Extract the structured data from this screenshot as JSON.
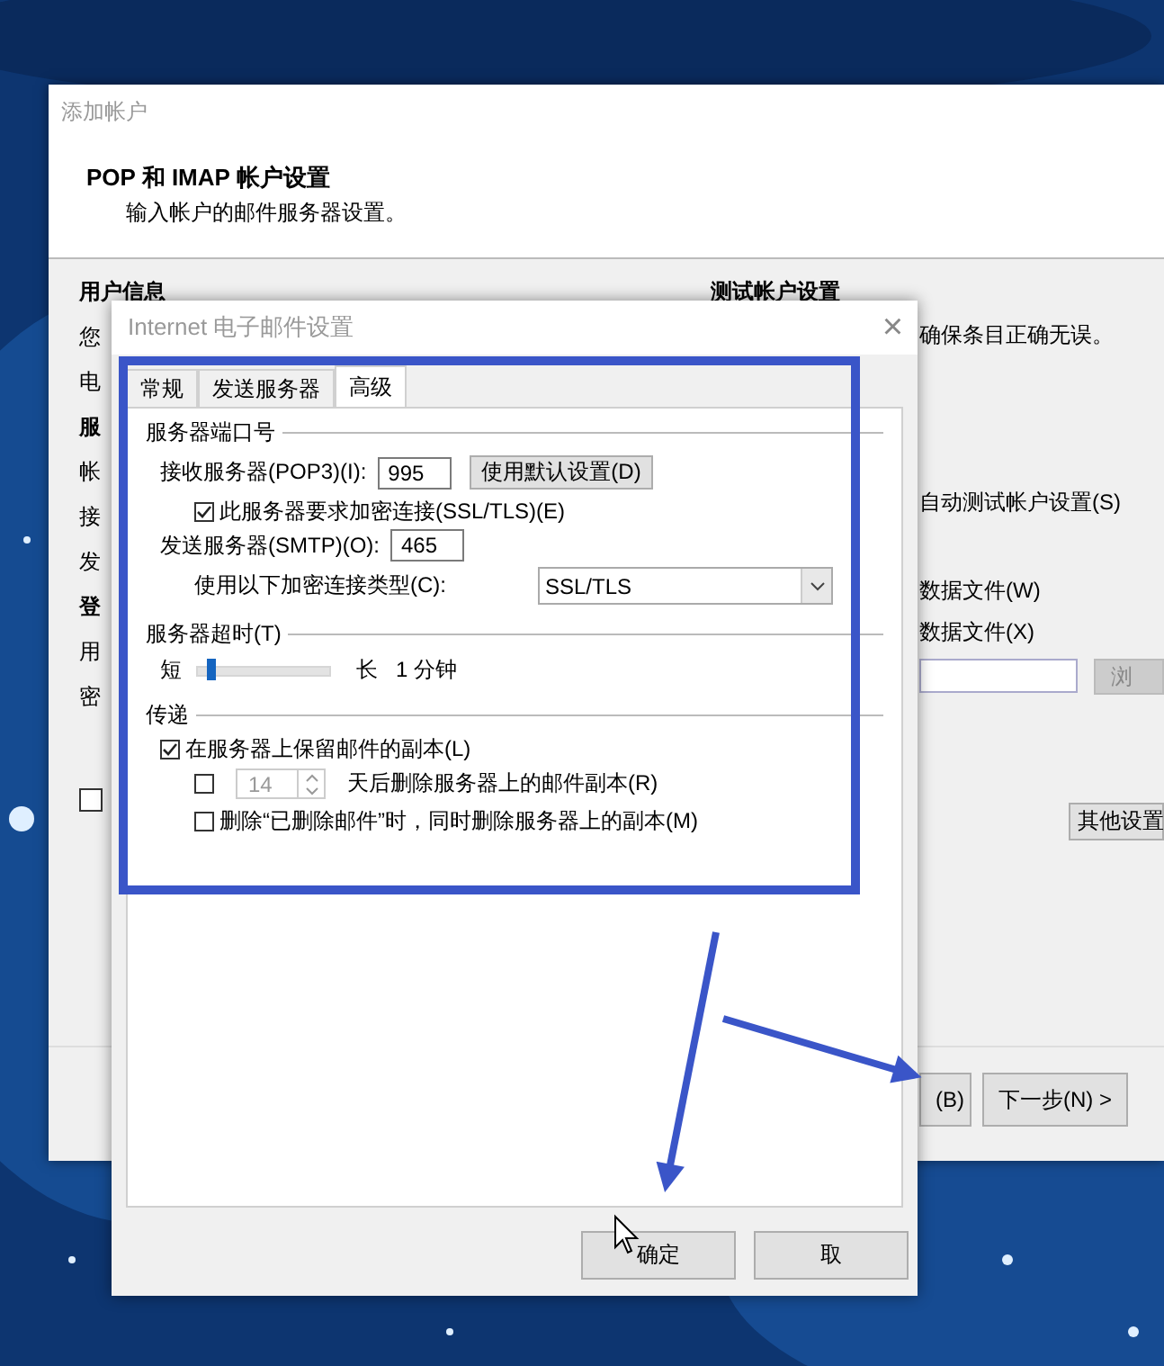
{
  "main_window": {
    "title": "添加帐户",
    "heading": "POP 和 IMAP 帐户设置",
    "subheading": "输入帐户的邮件服务器设置。",
    "left_labels": [
      {
        "text": "用户信息",
        "kind": "heading"
      },
      {
        "text": "您",
        "kind": "label"
      },
      {
        "text": "电",
        "kind": "label"
      },
      {
        "text": "服",
        "kind": "heading"
      },
      {
        "text": "帐",
        "kind": "label"
      },
      {
        "text": "接",
        "kind": "label"
      },
      {
        "text": "发",
        "kind": "label"
      },
      {
        "text": "登",
        "kind": "heading"
      },
      {
        "text": "用",
        "kind": "label"
      },
      {
        "text": "密",
        "kind": "label"
      }
    ],
    "left_checkbox": {
      "checked": false
    },
    "test_heading": "测试帐户设置",
    "test_note": "确保条目正确无误。",
    "auto_test_label": "自动测试帐户设置(S)",
    "data_file_options": [
      "数据文件(W)",
      "数据文件(X)"
    ],
    "browse_button": {
      "label": "浏",
      "disabled": true
    },
    "more_settings_button": "其他设置",
    "buttons": [
      "(B)",
      "下一步(N) >"
    ]
  },
  "dialog": {
    "title": "Internet 电子邮件设置",
    "close": "×",
    "tabs": [
      {
        "label": "常规",
        "selected": false
      },
      {
        "label": "发送服务器",
        "selected": false
      },
      {
        "label": "高级",
        "selected": true
      }
    ],
    "port_group": "服务器端口号",
    "incoming_label": "接收服务器(POP3)(I):",
    "incoming_port": "995",
    "default_button": "使用默认设置(D)",
    "ssl_checkbox": {
      "label": "此服务器要求加密连接(SSL/TLS)(E)",
      "checked": true
    },
    "outgoing_label": "发送服务器(SMTP)(O):",
    "outgoing_port": "465",
    "encryption_label": "使用以下加密连接类型(C):",
    "encryption_value": "SSL/TLS",
    "timeout_group": "服务器超时(T)",
    "timeout_short": "短",
    "timeout_long": "长",
    "timeout_slider": {
      "level": 0.1
    },
    "timeout_value": "1 分钟",
    "delivery_group": "传递",
    "leave_copy": {
      "label": "在服务器上保留邮件的副本(L)",
      "checked": true
    },
    "remove_after": {
      "checked": false,
      "days": "14",
      "label": "天后删除服务器上的邮件副本(R)"
    },
    "remove_deleted": {
      "label": "删除“已删除邮件”时，同时删除服务器上的副本(M)",
      "checked": false
    },
    "buttons": [
      "确定",
      "取"
    ]
  }
}
